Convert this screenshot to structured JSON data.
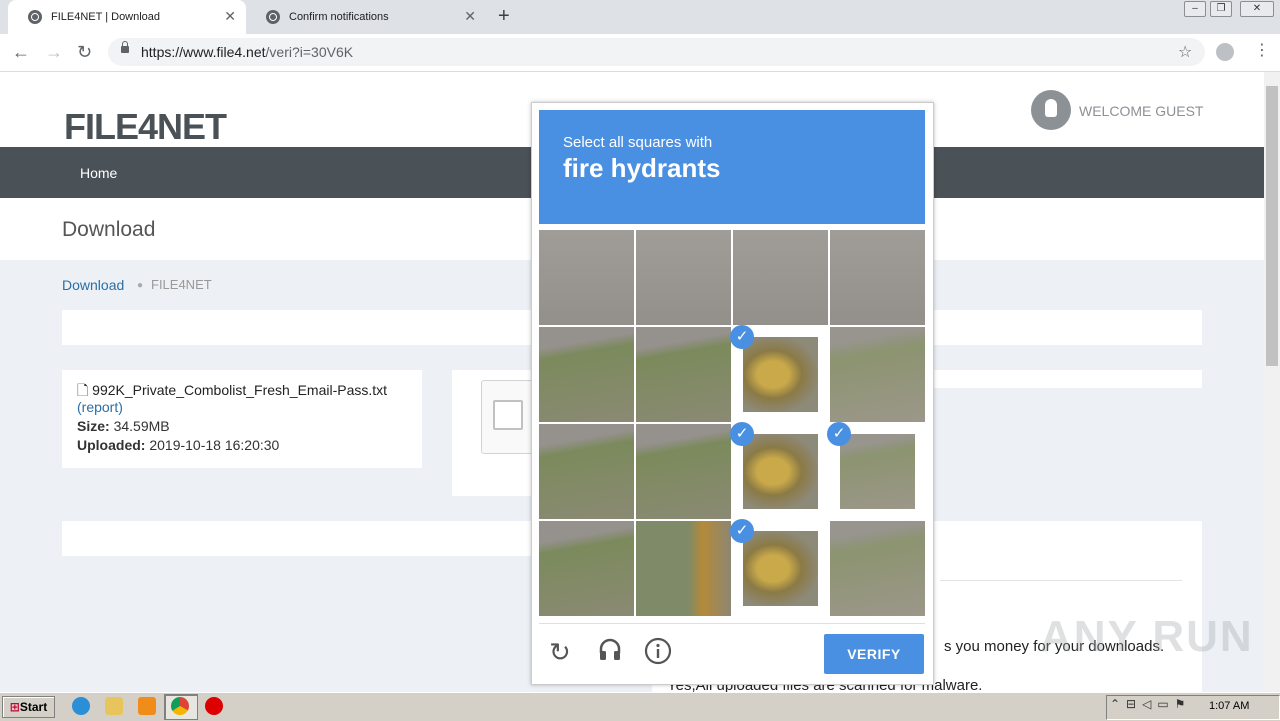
{
  "browser": {
    "tabs": [
      {
        "title": "FILE4NET | Download",
        "active": true
      },
      {
        "title": "Confirm notifications",
        "active": false
      }
    ],
    "new_tab_icon": "plus-icon",
    "url_host": "https://www.file4.net",
    "url_path": "/veri?i=30V6K"
  },
  "site": {
    "logo_text": "FILE4NET",
    "welcome": "WELCOME GUEST",
    "nav": [
      "Home"
    ],
    "page_title": "Download",
    "breadcrumb": {
      "link": "Download",
      "current": "FILE4NET"
    }
  },
  "file": {
    "name": "992K_Private_Combolist_Fresh_Email-Pass.txt",
    "report": "(report)",
    "size_label": "Size:",
    "size_value": "34.59MB",
    "uploaded_label": "Uploaded:",
    "uploaded_value": "2019-10-18 16:20:30"
  },
  "page_text": {
    "money": "s you money for your downloads.",
    "malware": "Yes,All uploaded files are scanned for malware."
  },
  "captcha": {
    "instruction": "Select all squares with",
    "target": "fire hydrants",
    "grid_rows": 4,
    "grid_cols": 4,
    "selected_tiles": [
      [
        1,
        2
      ],
      [
        2,
        2
      ],
      [
        2,
        3
      ],
      [
        3,
        2
      ]
    ],
    "verify_label": "VERIFY",
    "footer_icons": [
      "reload-icon",
      "audio-icon",
      "info-icon"
    ],
    "accent_color": "#4a90e2"
  },
  "watermark": "ANY RUN",
  "taskbar": {
    "start_label": "Start",
    "clock": "1:07 AM"
  }
}
